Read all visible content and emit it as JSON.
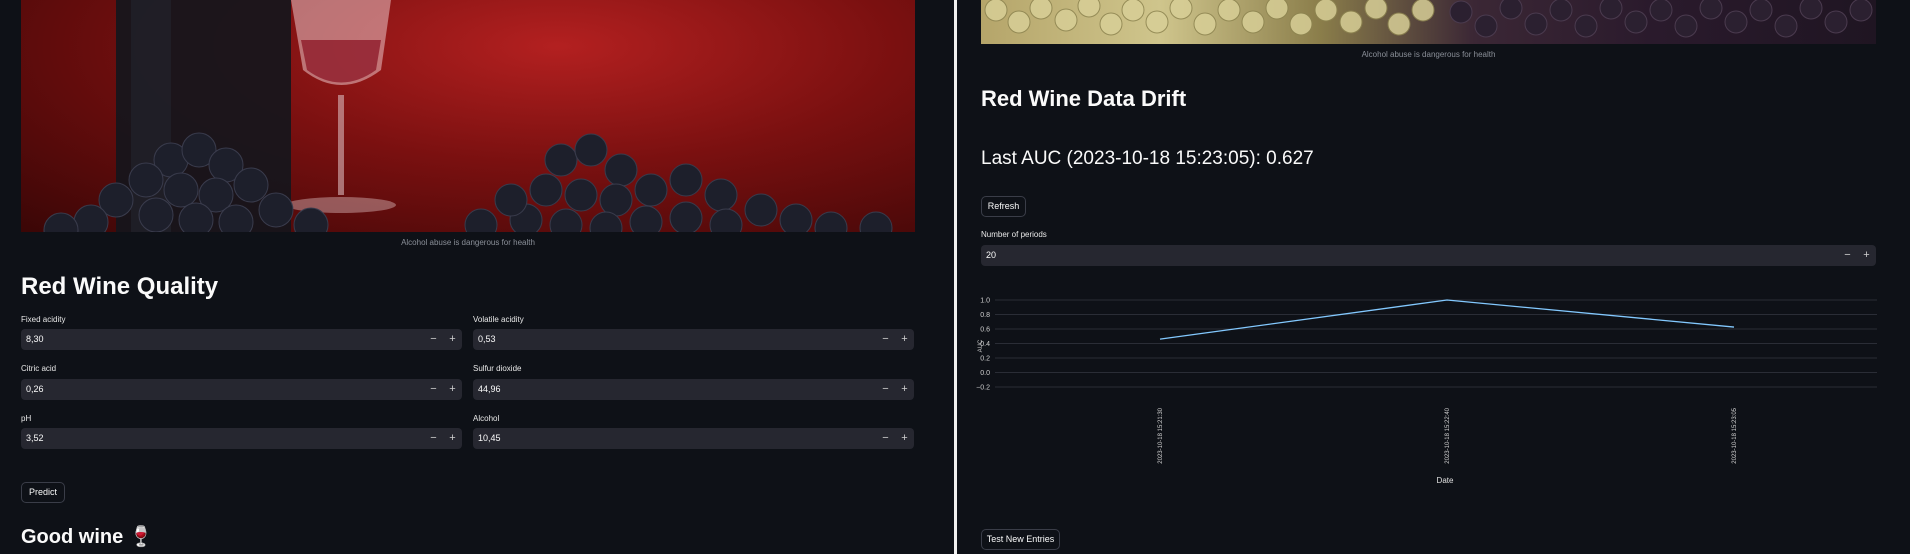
{
  "left": {
    "hero_caption": "Alcohol abuse is dangerous for health",
    "title": "Red Wine Quality",
    "fields": [
      {
        "label": "Fixed acidity",
        "value": "8,30"
      },
      {
        "label": "Volatile acidity",
        "value": "0,53"
      },
      {
        "label": "Citric acid",
        "value": "0,26"
      },
      {
        "label": "Sulfur dioxide",
        "value": "44,96"
      },
      {
        "label": "pH",
        "value": "3,52"
      },
      {
        "label": "Alcohol",
        "value": "10,45"
      }
    ],
    "minus_glyph": "−",
    "plus_glyph": "+",
    "predict_label": "Predict",
    "result_text": "Good wine 🍷"
  },
  "right": {
    "hero_caption": "Alcohol abuse is dangerous for health",
    "title": "Red Wine Data Drift",
    "auc_heading": "Last AUC (2023-10-18 15:23:05): 0.627",
    "refresh_label": "Refresh",
    "periods_label": "Number of periods",
    "periods_value": "20",
    "test_label": "Test New Entries"
  },
  "chart_data": {
    "type": "line",
    "x": [
      "2023-10-18 15:21:30",
      "2023-10-18 15:22:40",
      "2023-10-18 15:23:05"
    ],
    "values": [
      0.46,
      1.0,
      0.627
    ],
    "ylabel": "AUC",
    "xlabel": "Date",
    "ylim": [
      -0.2,
      1.0
    ],
    "yticks": [
      "1.0",
      "0.8",
      "0.6",
      "0.4",
      "0.2",
      "0.0",
      "−0.2"
    ],
    "grid": true,
    "line_color": "#83c9ff"
  }
}
